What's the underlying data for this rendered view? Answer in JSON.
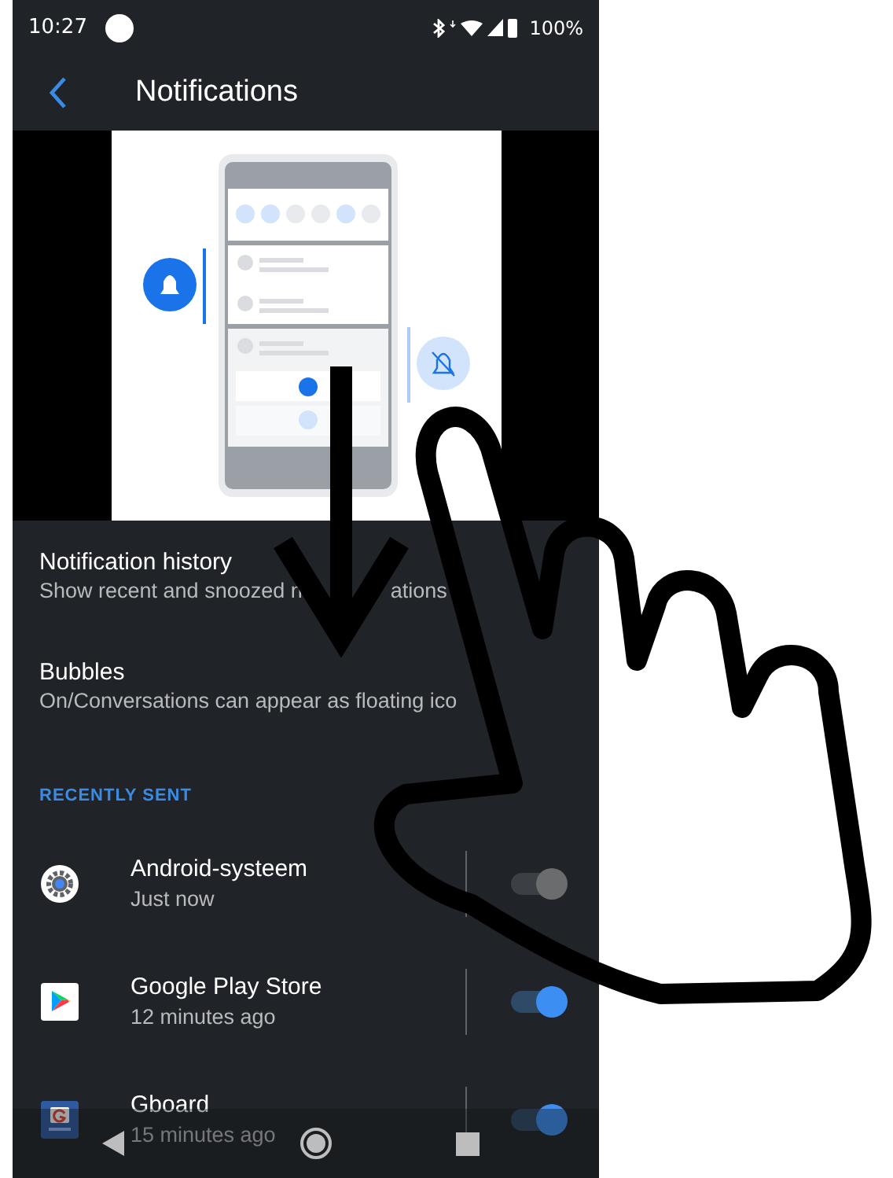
{
  "status_bar": {
    "time": "10:27",
    "battery": "100%"
  },
  "app_bar": {
    "title": "Notifications"
  },
  "settings": [
    {
      "title": "Notification history",
      "summary": "Show recent and snoozed n",
      "summary_tail": "ations"
    },
    {
      "title": "Bubbles",
      "summary": "On/Conversations can appear as floating ico"
    }
  ],
  "section_header": "RECENTLY SENT",
  "apps": [
    {
      "kind": "gear",
      "name": "Android-systeem",
      "time": "Just now",
      "on": true,
      "disabled": true
    },
    {
      "kind": "play",
      "name": "Google Play Store",
      "time": "12 minutes ago",
      "on": true,
      "disabled": false
    },
    {
      "kind": "keyboard",
      "name": "Gboard",
      "time": "15 minutes ago",
      "on": true,
      "disabled": false
    }
  ]
}
